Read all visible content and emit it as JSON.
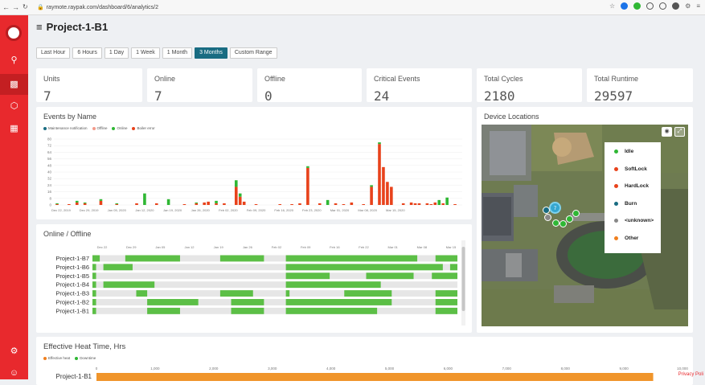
{
  "browser": {
    "url": "raymote.raypak.com/dashboard/6/analytics/2"
  },
  "project_title": "Project-1-B1",
  "time_tabs": [
    "Last Hour",
    "6 Hours",
    "1 Day",
    "1 Week",
    "1 Month",
    "3 Months",
    "Custom Range"
  ],
  "selected_tab": "3 Months",
  "stats": [
    {
      "label": "Units",
      "value": "7"
    },
    {
      "label": "Online",
      "value": "7"
    },
    {
      "label": "Offline",
      "value": "0"
    },
    {
      "label": "Critical Events",
      "value": "24"
    },
    {
      "label": "Total Cycles",
      "value": "2180"
    },
    {
      "label": "Total Runtime",
      "value": "29597"
    }
  ],
  "events_card": {
    "title": "Events by Name"
  },
  "online_card": {
    "title": "Online / Offline"
  },
  "map_card": {
    "title": "Device Locations",
    "cluster_count": "7"
  },
  "map_legend": [
    {
      "label": "Idle",
      "color": "#2fb734"
    },
    {
      "label": "SoftLock",
      "color": "#e8421b"
    },
    {
      "label": "HardLock",
      "color": "#e8421b"
    },
    {
      "label": "Burn",
      "color": "#196c82"
    },
    {
      "label": "<unknown>",
      "color": "#888888"
    },
    {
      "label": "Other",
      "color": "#f07f1e"
    }
  ],
  "heat_card": {
    "title": "Effective Heat Time, Hrs"
  },
  "privacy": "Privacy Poli",
  "chart_data": [
    {
      "type": "bar",
      "title": "Events by Name",
      "legend": [
        {
          "name": "Maintenance notification",
          "color": "#196c82"
        },
        {
          "name": "Offline",
          "color": "#f39a8a"
        },
        {
          "name": "Online",
          "color": "#2fb734"
        },
        {
          "name": "Boiler error",
          "color": "#e8421b"
        }
      ],
      "x_ticks": [
        "Dec 22, 2019",
        "Dec 29, 2019",
        "Jan 05, 2020",
        "Jan 12, 2020",
        "Jan 19, 2020",
        "Jan 26, 2020",
        "Feb 02, 2020",
        "Feb 09, 2020",
        "Feb 16, 2020",
        "Feb 23, 2020",
        "Mar 01, 2020",
        "Mar 08, 2020",
        "Mar 15, 2020"
      ],
      "y_ticks": [
        0,
        8,
        16,
        24,
        32,
        40,
        48,
        56,
        64,
        72,
        80
      ],
      "ylim": [
        0,
        80
      ],
      "bars": [
        {
          "day": 0,
          "red": 1,
          "green": 1
        },
        {
          "day": 3,
          "red": 1
        },
        {
          "day": 5,
          "red": 3,
          "green": 2
        },
        {
          "day": 7,
          "red": 2,
          "green": 1
        },
        {
          "day": 11,
          "red": 5,
          "green": 2
        },
        {
          "day": 15,
          "red": 1,
          "green": 1
        },
        {
          "day": 20,
          "red": 2
        },
        {
          "day": 22,
          "green": 14
        },
        {
          "day": 25,
          "red": 2
        },
        {
          "day": 28,
          "green": 7
        },
        {
          "day": 32,
          "red": 1
        },
        {
          "day": 35,
          "red": 2,
          "green": 1
        },
        {
          "day": 37,
          "red": 3
        },
        {
          "day": 38,
          "red": 4
        },
        {
          "day": 40,
          "red": 2,
          "green": 3
        },
        {
          "day": 42,
          "red": 2
        },
        {
          "day": 45,
          "red": 22,
          "green": 8
        },
        {
          "day": 46,
          "red": 10,
          "green": 4
        },
        {
          "day": 47,
          "red": 4
        },
        {
          "day": 50,
          "red": 1
        },
        {
          "day": 56,
          "red": 1
        },
        {
          "day": 59,
          "red": 1
        },
        {
          "day": 61,
          "red": 2
        },
        {
          "day": 63,
          "red": 45,
          "green": 2
        },
        {
          "day": 66,
          "red": 2
        },
        {
          "day": 68,
          "green": 6
        },
        {
          "day": 70,
          "red": 2
        },
        {
          "day": 72,
          "red": 1
        },
        {
          "day": 74,
          "red": 3
        },
        {
          "day": 77,
          "red": 1
        },
        {
          "day": 79,
          "red": 22,
          "green": 2
        },
        {
          "day": 81,
          "red": 74,
          "green": 2
        },
        {
          "day": 82,
          "red": 46
        },
        {
          "day": 83,
          "red": 28
        },
        {
          "day": 84,
          "red": 22
        },
        {
          "day": 87,
          "red": 2
        },
        {
          "day": 89,
          "red": 3
        },
        {
          "day": 90,
          "red": 2
        },
        {
          "day": 91,
          "red": 2
        },
        {
          "day": 93,
          "red": 2
        },
        {
          "day": 94,
          "red": 1
        },
        {
          "day": 95,
          "red": 3
        },
        {
          "day": 96,
          "green": 6
        },
        {
          "day": 97,
          "red": 2
        },
        {
          "day": 98,
          "green": 9
        },
        {
          "day": 100,
          "red": 1
        }
      ]
    },
    {
      "type": "timeline",
      "title": "Online / Offline",
      "x_ticks": [
        "Dec 22",
        "Dec 29",
        "Jan 05",
        "Jan 12",
        "Jan 19",
        "Jan 26",
        "Feb 02",
        "Feb 09",
        "Feb 16",
        "Feb 22",
        "Mar 01",
        "Mar 08",
        "Mar 15"
      ],
      "rows": [
        {
          "name": "Project-1-B7",
          "online": [
            [
              0.0,
              0.02
            ],
            [
              0.09,
              0.24
            ],
            [
              0.35,
              0.47
            ],
            [
              0.53,
              0.89
            ],
            [
              0.94,
              1.0
            ]
          ]
        },
        {
          "name": "Project-1-B6",
          "online": [
            [
              0.0,
              0.01
            ],
            [
              0.03,
              0.11
            ],
            [
              0.53,
              0.96
            ],
            [
              0.98,
              1.0
            ]
          ]
        },
        {
          "name": "Project-1-B5",
          "online": [
            [
              0.0,
              0.01
            ],
            [
              0.53,
              0.65
            ],
            [
              0.75,
              0.88
            ],
            [
              0.93,
              1.0
            ]
          ]
        },
        {
          "name": "Project-1-B4",
          "online": [
            [
              0.0,
              0.01
            ],
            [
              0.03,
              0.17
            ],
            [
              0.53,
              0.79
            ]
          ]
        },
        {
          "name": "Project-1-B3",
          "online": [
            [
              0.0,
              0.01
            ],
            [
              0.12,
              0.15
            ],
            [
              0.35,
              0.44
            ],
            [
              0.53,
              0.54
            ],
            [
              0.69,
              0.82
            ],
            [
              0.94,
              1.0
            ]
          ]
        },
        {
          "name": "Project-1-B2",
          "online": [
            [
              0.0,
              0.01
            ],
            [
              0.15,
              0.29
            ],
            [
              0.38,
              0.47
            ],
            [
              0.53,
              0.82
            ],
            [
              0.94,
              1.0
            ]
          ]
        },
        {
          "name": "Project-1-B1",
          "online": [
            [
              0.0,
              0.01
            ],
            [
              0.15,
              0.24
            ],
            [
              0.38,
              0.47
            ],
            [
              0.53,
              0.78
            ],
            [
              0.94,
              1.0
            ]
          ]
        }
      ]
    },
    {
      "type": "bar",
      "title": "Effective Heat Time, Hrs",
      "legend": [
        {
          "name": "Effective heat",
          "color": "#f07f1e"
        },
        {
          "name": "Downtime",
          "color": "#2fb734"
        }
      ],
      "x_ticks": [
        "0",
        "1,000",
        "2,000",
        "3,000",
        "4,000",
        "5,000",
        "6,000",
        "7,000",
        "8,000",
        "9,000",
        "10,000"
      ],
      "xlim": [
        0,
        10000
      ],
      "categories": [
        "Project-1-B1"
      ],
      "values": [
        9500
      ]
    }
  ]
}
